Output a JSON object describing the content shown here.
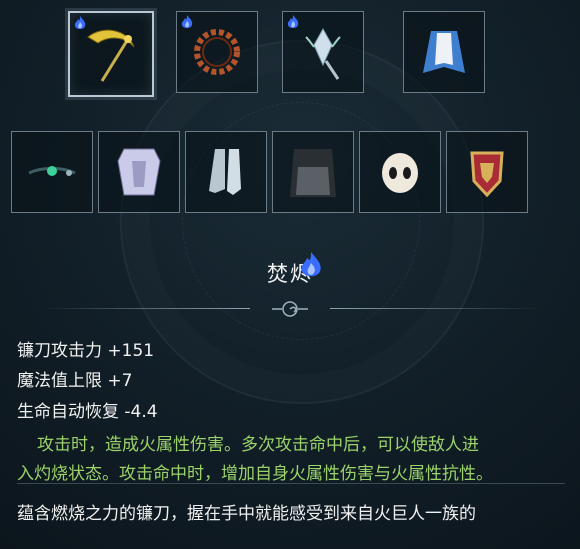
{
  "item": {
    "name": "焚烬",
    "stats": [
      "镰刀攻击力 +151",
      "魔法值上限 +7",
      "生命自动恢复 -4.4"
    ],
    "effect_lines": [
      "攻击时，造成火属性伤害。多次攻击命中后，可以使敌人进",
      "入灼烧状态。攻击命中时，增加自身火属性伤害与火属性抗性。"
    ],
    "lore": "蕴含燃烧之力的镰刀，握在手中就能感受到来自火巨人一族的"
  },
  "equipment_row1": [
    {
      "name": "scythe-weapon-icon",
      "selected": true,
      "fire": true
    },
    {
      "name": "thorn-ring-icon",
      "selected": false,
      "fire": true
    },
    {
      "name": "crystal-amulet-icon",
      "selected": false,
      "fire": true
    },
    {
      "name": "cape-icon",
      "selected": false,
      "fire": false
    }
  ],
  "equipment_row2": [
    "circlet-icon",
    "chest-armor-icon",
    "boots-icon",
    "scale-cloak-icon",
    "skull-mask-icon",
    "crest-shield-icon"
  ],
  "colors": {
    "effect_text": "#9bd36a",
    "fire_blue": "#3a6cff",
    "slot_border": "#6c7b86"
  }
}
